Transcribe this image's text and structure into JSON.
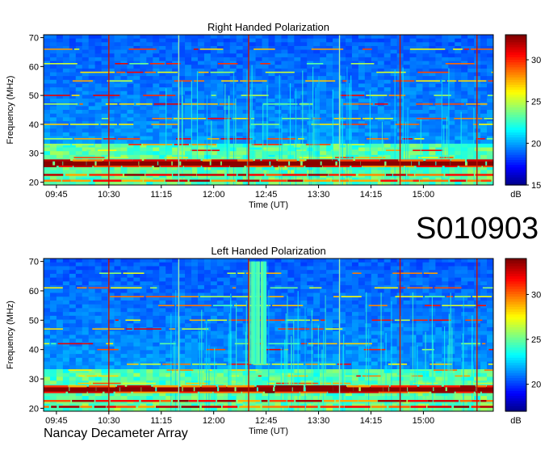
{
  "observation_id": "S010903",
  "footer_label": "Nancay Decameter Array",
  "chart_data": [
    {
      "type": "heatmap",
      "title": "Right Handed Polarization",
      "xlabel": "Time (UT)",
      "ylabel": "Frequency (MHz)",
      "x_tick_labels": [
        "09:45",
        "10:30",
        "11:15",
        "12:00",
        "12:45",
        "13:30",
        "14:15",
        "15:00"
      ],
      "x_ticks_minutes": [
        585,
        630,
        675,
        720,
        765,
        810,
        855,
        900
      ],
      "xlim_minutes": [
        574,
        960
      ],
      "ylim": [
        19,
        71
      ],
      "y_ticks": [
        20,
        30,
        40,
        50,
        60,
        70
      ],
      "colorbar": {
        "label": "dB",
        "ticks": [
          15,
          20,
          25,
          30
        ],
        "range": [
          15,
          33
        ]
      },
      "strong_bands_mhz": [
        20.5,
        22.5,
        25.5,
        26.5,
        27.5
      ],
      "interference_lines_mhz": [
        28.5,
        31,
        33,
        35,
        40,
        42,
        47,
        50,
        55,
        58,
        61,
        66
      ],
      "vertical_lines_time": [
        "10:30",
        "11:30",
        "12:30",
        "13:48",
        "14:40",
        "15:46"
      ],
      "burst": null
    },
    {
      "type": "heatmap",
      "title": "Left Handed Polarization",
      "xlabel": "Time (UT)",
      "ylabel": "Frequency (MHz)",
      "x_tick_labels": [
        "09:45",
        "10:30",
        "11:15",
        "12:00",
        "12:45",
        "13:30",
        "14:15",
        "15:00"
      ],
      "x_ticks_minutes": [
        585,
        630,
        675,
        720,
        765,
        810,
        855,
        900
      ],
      "xlim_minutes": [
        574,
        960
      ],
      "ylim": [
        19,
        71
      ],
      "y_ticks": [
        20,
        30,
        40,
        50,
        60,
        70
      ],
      "colorbar": {
        "label": "dB",
        "ticks": [
          20,
          25,
          30
        ],
        "range": [
          17,
          34
        ]
      },
      "strong_bands_mhz": [
        20.5,
        22.5,
        25.5,
        26.5,
        27.5
      ],
      "interference_lines_mhz": [
        28.5,
        31,
        33,
        35,
        40,
        42,
        47,
        50,
        55,
        58,
        61,
        66
      ],
      "vertical_lines_time": [
        "10:30",
        "11:30",
        "12:30",
        "13:48",
        "14:40",
        "15:46"
      ],
      "burst": {
        "start_minutes": 749,
        "end_minutes": 765,
        "fmin_mhz": 35,
        "fmax_mhz": 70
      }
    }
  ]
}
